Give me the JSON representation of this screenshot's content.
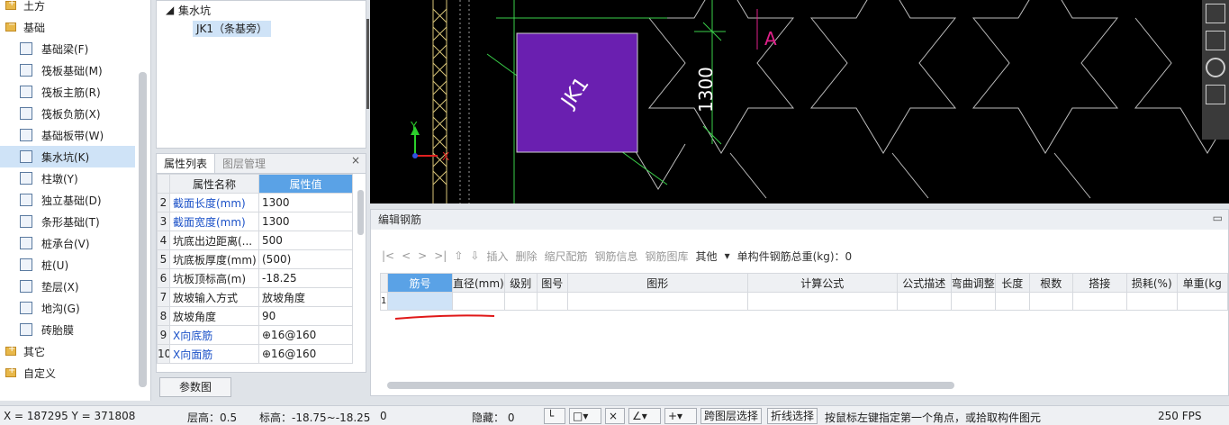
{
  "tree": {
    "items": [
      {
        "label": "土方",
        "type": "folder",
        "open": false
      },
      {
        "label": "基础",
        "type": "folder",
        "open": true
      },
      {
        "label": "基础梁(F)"
      },
      {
        "label": "筏板基础(M)"
      },
      {
        "label": "筏板主筋(R)"
      },
      {
        "label": "筏板负筋(X)"
      },
      {
        "label": "基础板带(W)"
      },
      {
        "label": "集水坑(K)",
        "selected": true
      },
      {
        "label": "柱墩(Y)"
      },
      {
        "label": "独立基础(D)"
      },
      {
        "label": "条形基础(T)"
      },
      {
        "label": "桩承台(V)"
      },
      {
        "label": "桩(U)"
      },
      {
        "label": "垫层(X)"
      },
      {
        "label": "地沟(G)"
      },
      {
        "label": "砖胎膜"
      },
      {
        "label": "其它",
        "type": "folder",
        "open": false
      },
      {
        "label": "自定义",
        "type": "folder",
        "open": false
      }
    ]
  },
  "component_tree": {
    "root": "集水坑",
    "child": "JK1（条基旁）"
  },
  "props": {
    "tab_active": "属性列表",
    "tab_other": "图层管理",
    "col_name": "属性名称",
    "col_value": "属性值",
    "rows": [
      {
        "n": "2",
        "name": "截面长度(mm)",
        "value": "1300",
        "blue": true
      },
      {
        "n": "3",
        "name": "截面宽度(mm)",
        "value": "1300",
        "blue": true
      },
      {
        "n": "4",
        "name": "坑底出边距离(...",
        "value": "500"
      },
      {
        "n": "5",
        "name": "坑底板厚度(mm)",
        "value": "(500)"
      },
      {
        "n": "6",
        "name": "坑板顶标高(m)",
        "value": "-18.25"
      },
      {
        "n": "7",
        "name": "放坡输入方式",
        "value": "放坡角度"
      },
      {
        "n": "8",
        "name": "放坡角度",
        "value": "90"
      },
      {
        "n": "9",
        "name": "X向底筋",
        "value": "⊕16@160",
        "blue": true
      },
      {
        "n": "10",
        "name": "X向面筋",
        "value": "⊕16@160",
        "blue": true
      }
    ],
    "params_button": "参数图"
  },
  "canvas": {
    "pit_label": "JK1",
    "dim_label": "1300",
    "axis_y": "Y",
    "axis_x": "X",
    "marker": "A",
    "pit_color": "#6a1fb0"
  },
  "rebar": {
    "title": "编辑钢筋",
    "toolbar": [
      "插入",
      "删除",
      "缩尺配筋",
      "钢筋信息",
      "钢筋图库"
    ],
    "other": "其他",
    "total": "单构件钢筋总重(kg)：0",
    "headers": [
      "筋号",
      "直径(mm)",
      "级别",
      "图号",
      "图形",
      "计算公式",
      "公式描述",
      "弯曲调整",
      "长度",
      "根数",
      "搭接",
      "损耗(%)",
      "单重(kg"
    ],
    "row_no": "1"
  },
  "status": {
    "coords": "X = 187295 Y = 371808",
    "floor_h": "层高：0.5",
    "elev": "标高：-18.75~-18.25",
    "zero": "0",
    "hidden": "隐藏： 0",
    "btn_layer": "跨图层选择",
    "btn_polyline": "折线选择",
    "hint": "按鼠标左键指定第一个角点，或拾取构件图元",
    "fps": "250 FPS"
  }
}
